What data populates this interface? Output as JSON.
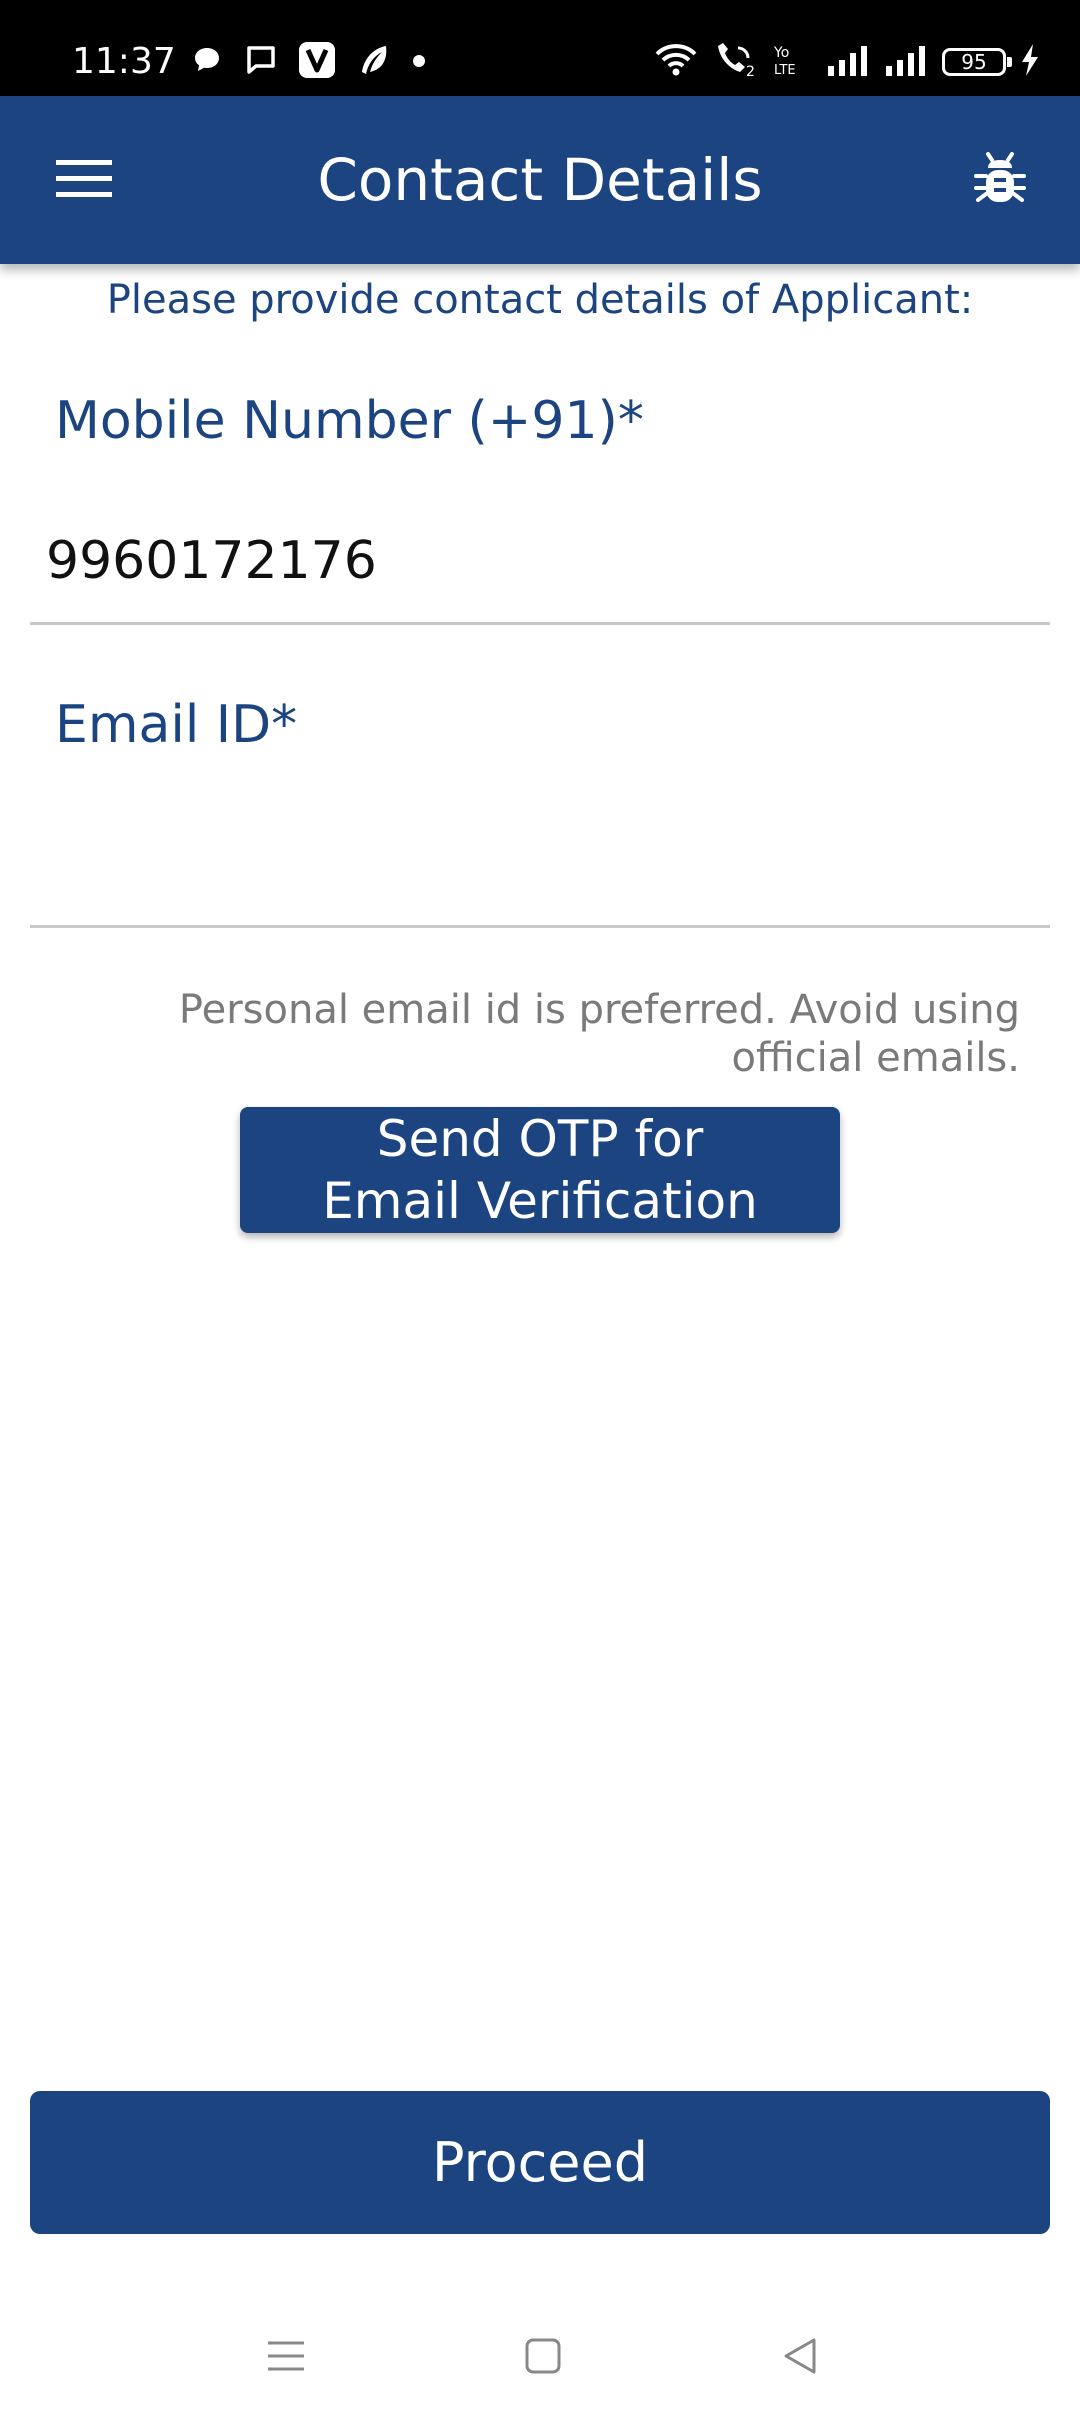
{
  "status_bar": {
    "time": "11:37",
    "battery_level": "95",
    "left_icons": [
      "chat-bubble-icon",
      "message-icon",
      "v-app-icon",
      "feather-app-icon",
      "dot-icon"
    ],
    "right_icons": [
      "wifi-icon",
      "wifi-calling-icon",
      "volte-icon",
      "signal-icon",
      "signal-icon",
      "battery-icon",
      "charging-icon"
    ]
  },
  "app_bar": {
    "title": "Contact Details",
    "menu_icon": "hamburger-menu-icon",
    "right_icon": "bug-icon",
    "color": "#1b4480"
  },
  "form": {
    "subtitle": "Please provide contact details of Applicant:",
    "mobile": {
      "label": "Mobile Number (+91)*",
      "value": "9960172176"
    },
    "email": {
      "label": "Email ID*",
      "value": ""
    },
    "hint_line1": "Personal email id is preferred. Avoid using",
    "hint_line2": "official emails.",
    "otp_button_line1": "Send OTP for",
    "otp_button_line2": "Email Verification",
    "proceed_label": "Proceed"
  },
  "nav_bar": {
    "icons": [
      "recents-icon",
      "home-icon",
      "back-icon"
    ]
  }
}
